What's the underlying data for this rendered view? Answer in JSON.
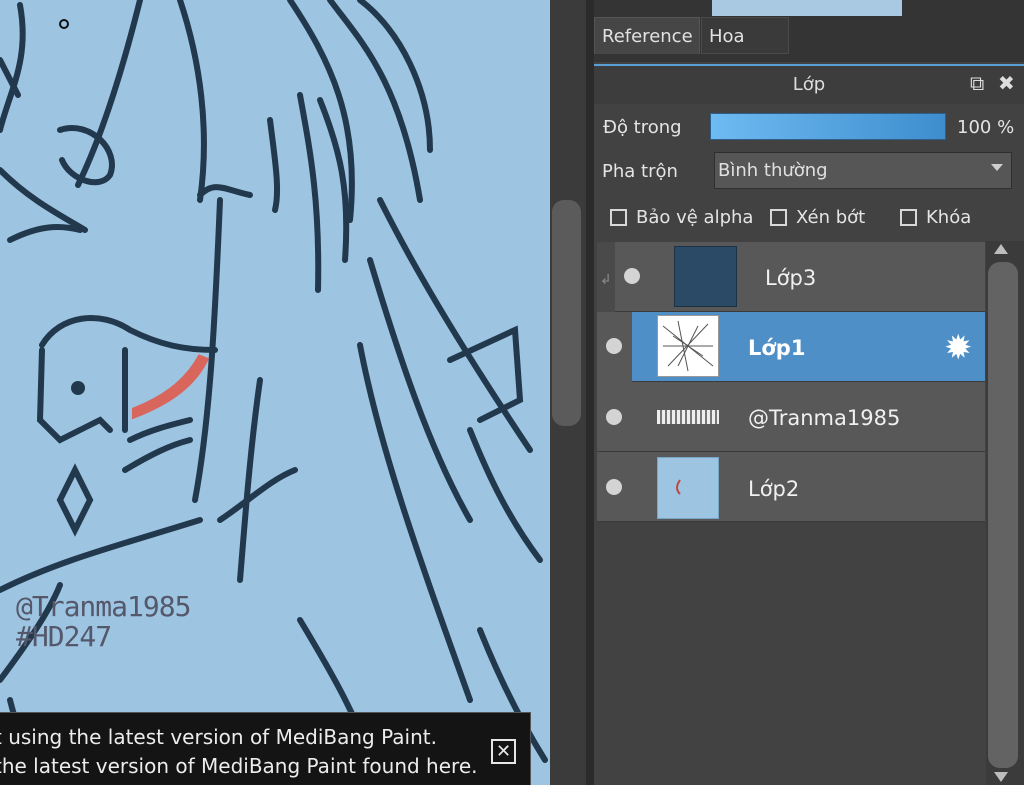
{
  "canvas": {
    "watermark_line1": "@Tranma1985",
    "watermark_line2": "#HD247",
    "background_color": "#9dc4e1",
    "stroke_color": "#22384d",
    "accent_color": "#d9665c"
  },
  "notice": {
    "line1": "t using the latest version of MediBang Paint.",
    "line2": "the latest version of MediBang Paint found here.",
    "close_icon": "close-icon"
  },
  "tabs": [
    {
      "label": "Reference",
      "active": true
    },
    {
      "label": "Hoa tiêu",
      "active": false
    }
  ],
  "layers_panel": {
    "title": "Lớp",
    "opacity_label": "Độ trong",
    "opacity_value": "100 %",
    "blend_label": "Pha trộn",
    "blend_value": "Bình thường",
    "checkboxes": [
      {
        "label": "Bảo vệ alpha",
        "checked": false
      },
      {
        "label": "Xén bớt",
        "checked": false
      },
      {
        "label": "Khóa",
        "checked": false
      }
    ],
    "layers": [
      {
        "name": "Lớp3",
        "selected": false,
        "clipped": true
      },
      {
        "name": "Lớp1",
        "selected": true,
        "clipped": false
      },
      {
        "name": "@Tranma1985",
        "selected": false,
        "clipped": false
      },
      {
        "name": "Lớp2",
        "selected": false,
        "clipped": false
      }
    ],
    "accent_color": "#4f8fc7"
  }
}
